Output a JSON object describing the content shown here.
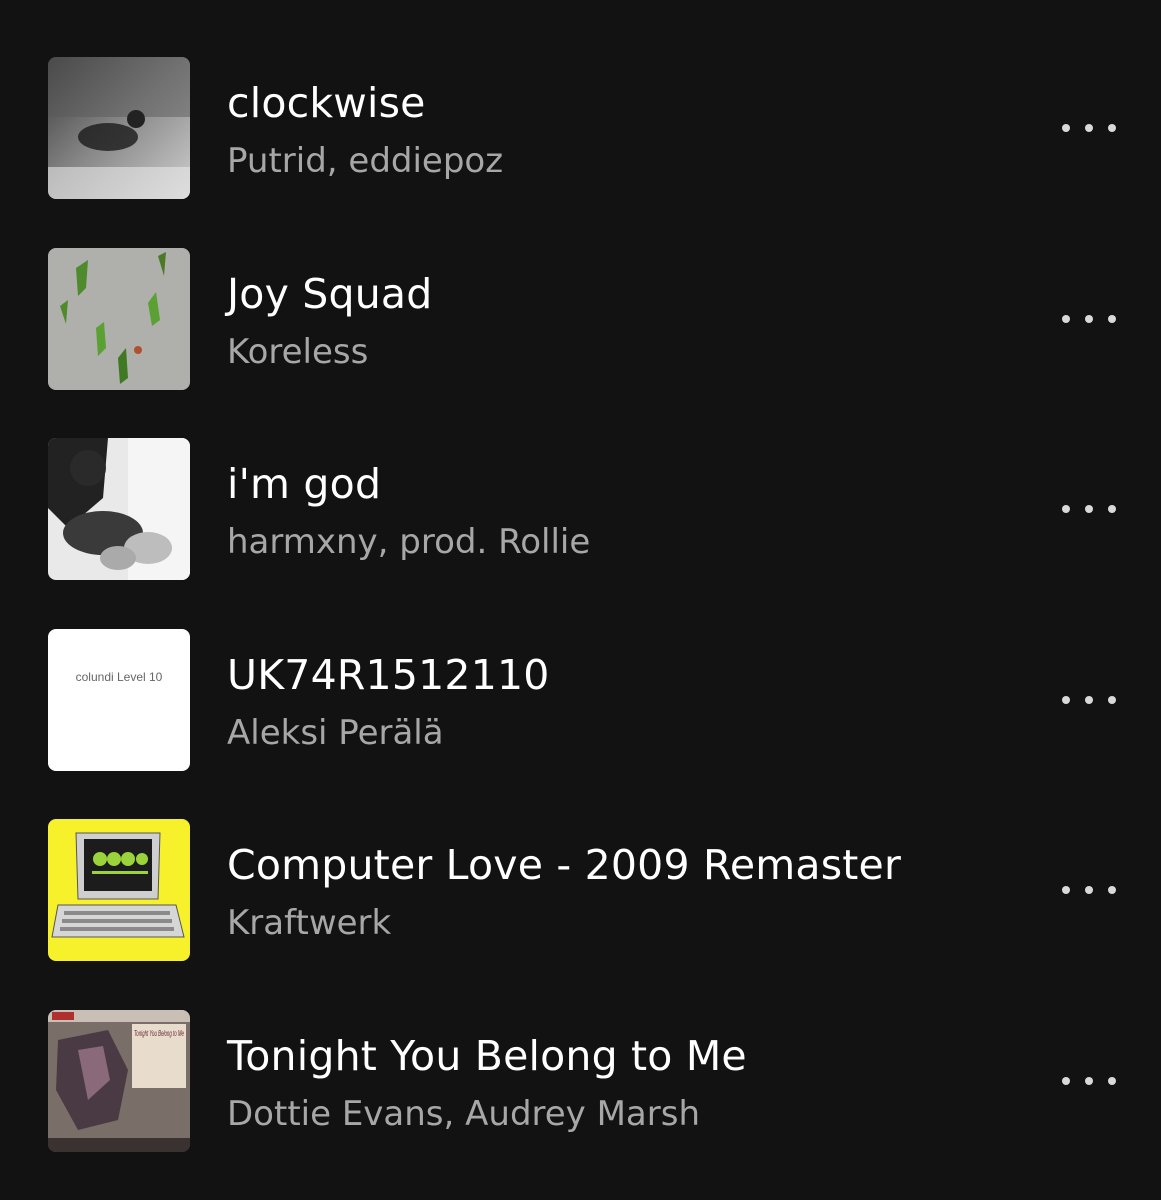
{
  "tracks": [
    {
      "title": "clockwise",
      "artist": "Putrid, eddiepoz",
      "cover_icon": "album-cover-clockwise"
    },
    {
      "title": "Joy Squad",
      "artist": "Koreless",
      "cover_icon": "album-cover-joy-squad"
    },
    {
      "title": "i'm god",
      "artist": "harmxny, prod. Rollie",
      "cover_icon": "album-cover-im-god"
    },
    {
      "title": "UK74R1512110",
      "artist": "Aleksi Perälä",
      "cover_icon": "album-cover-colundi-level-10",
      "cover_text": "colundi  Level 10"
    },
    {
      "title": "Computer Love - 2009 Remaster",
      "artist": "Kraftwerk",
      "cover_icon": "album-cover-computer-world"
    },
    {
      "title": "Tonight You Belong to Me",
      "artist": "Dottie Evans, Audrey Marsh",
      "cover_icon": "album-cover-tonight-you-belong-to-me",
      "cover_text": "Tonight You Belong to Me"
    }
  ],
  "colors": {
    "background": "#121212",
    "title": "#ffffff",
    "artist": "#a7a7a7",
    "more_dots": "#d9d9d9",
    "computer_world_yellow": "#f6f12a"
  },
  "more_icon": "more-options-icon"
}
